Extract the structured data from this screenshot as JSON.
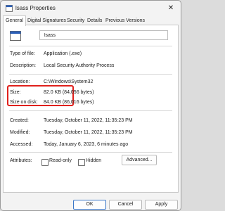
{
  "window": {
    "title": "lsass Properties"
  },
  "tabs": [
    "General",
    "Digital Signatures",
    "Security",
    "Details",
    "Previous Versions"
  ],
  "file": {
    "name": "lsass"
  },
  "rows": {
    "type_label": "Type of file:",
    "type_value": "Application (.exe)",
    "desc_label": "Description:",
    "desc_value": "Local Security Authority Process",
    "loc_label": "Location:",
    "loc_value": "C:\\Windows\\System32",
    "size_label": "Size:",
    "size_value": "82.0 KB (84,056 bytes)",
    "disk_label": "Size on disk:",
    "disk_value": "84.0 KB (86,016 bytes)",
    "created_label": "Created:",
    "created_value": "Tuesday, October 11, 2022, 11:35:23 PM",
    "modified_label": "Modified:",
    "modified_value": "Tuesday, October 11, 2022, 11:35:23 PM",
    "accessed_label": "Accessed:",
    "accessed_value": "Today, January 6, 2023, 6 minutes ago",
    "attr_label": "Attributes:"
  },
  "attributes": {
    "readonly": "Read-only",
    "hidden": "Hidden",
    "advanced": "Advanced..."
  },
  "buttons": {
    "ok": "OK",
    "cancel": "Cancel",
    "apply": "Apply"
  },
  "colors": {
    "highlight": "#e0201c",
    "ok_border": "#3a76c7"
  }
}
